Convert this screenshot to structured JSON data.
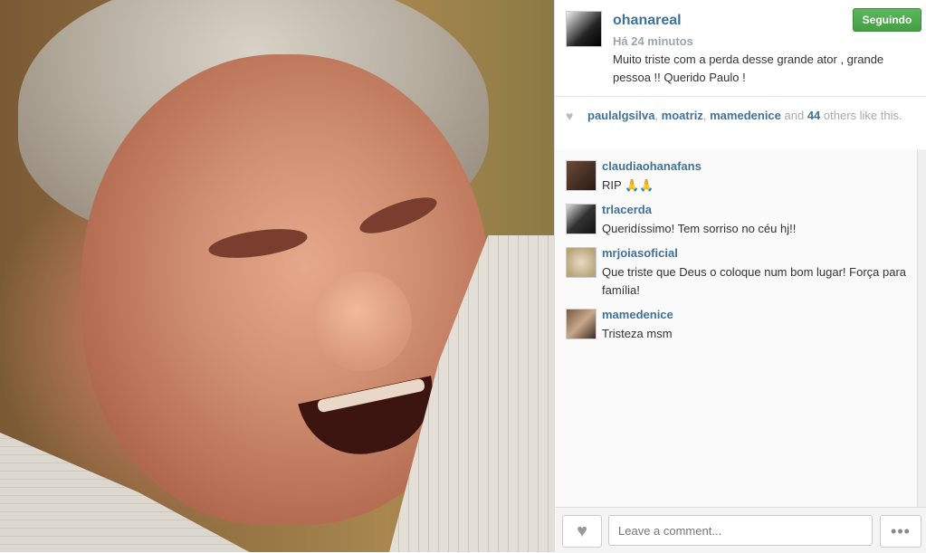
{
  "post": {
    "username": "ohanareal",
    "time": "Há 24 minutos",
    "caption": "Muito triste com a perda desse grande ator , grande pessoa !! Querido Paulo !",
    "follow_label": "Seguindo",
    "colors": {
      "follow": "#5cb85c",
      "username": "#3f729b"
    }
  },
  "likes": {
    "user1": "paulalgsilva",
    "sep1": ", ",
    "user2": "moatriz",
    "sep2": ", ",
    "user3": "mamedenice",
    "and": " and ",
    "count": "44",
    "rest": " others like this."
  },
  "comments": [
    {
      "user": "claudiaohanafans",
      "text": "RIP 🙏🙏"
    },
    {
      "user": "trlacerda",
      "text": "Queridíssimo! Tem sorriso no céu hj!!"
    },
    {
      "user": "mrjoiasoficial",
      "text": "Que triste que Deus o coloque num bom lugar! Força para família!"
    },
    {
      "user": "mamedenice",
      "text": "Tristeza msm"
    }
  ],
  "footer": {
    "comment_placeholder": "Leave a comment...",
    "more_label": "•••",
    "like_icon": "♥"
  }
}
